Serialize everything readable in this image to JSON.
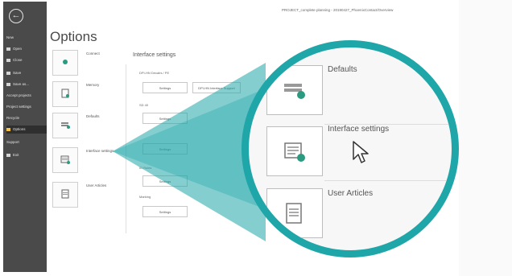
{
  "titlebar": {
    "text": "PROJECT_complete planning - 20190427_PhoenixContact/Overview"
  },
  "sidebar": {
    "back_icon": "back-arrow-icon",
    "items": [
      {
        "label": "New",
        "icon": ""
      },
      {
        "label": "Open",
        "icon": "open-icon"
      },
      {
        "label": "Close",
        "icon": "close-icon"
      },
      {
        "label": "Save",
        "icon": "save-icon"
      },
      {
        "label": "Save as...",
        "icon": "save-as-icon"
      },
      {
        "label": "Accept projects",
        "icon": ""
      },
      {
        "label": "Project settings",
        "icon": ""
      },
      {
        "label": "Recycle",
        "icon": ""
      },
      {
        "label": "Options",
        "icon": "options-icon",
        "active": true
      },
      {
        "label": "Support",
        "icon": ""
      },
      {
        "label": "Exit",
        "icon": "exit-icon"
      }
    ]
  },
  "main": {
    "page_title": "Options",
    "tiles": [
      {
        "label": "Connect",
        "icon": "connect-icon"
      },
      {
        "label": "Memory",
        "icon": "memory-icon"
      },
      {
        "label": "Defaults",
        "icon": "defaults-icon"
      },
      {
        "label": "Interface settings",
        "icon": "interface-settings-icon"
      },
      {
        "label": "User Articles",
        "icon": "user-articles-icon"
      }
    ],
    "panel_heading": "Interface settings",
    "groups": [
      {
        "label": "DPI-HN Decalrs / PE",
        "buttons": [
          "Settings",
          "DPI-HN Interface Support"
        ]
      },
      {
        "label": "SD 40",
        "buttons": [
          "Settings"
        ]
      },
      {
        "label": "",
        "buttons": [
          "Settings"
        ]
      },
      {
        "label": "ID Rules",
        "buttons": [
          "Settings"
        ]
      },
      {
        "label": "Marking",
        "buttons": [
          "Settings"
        ]
      }
    ]
  },
  "lens": {
    "items": [
      {
        "label": "Defaults",
        "icon": "defaults-icon"
      },
      {
        "label": "Interface settings",
        "icon": "interface-settings-icon"
      },
      {
        "label": "User Articles",
        "icon": "user-articles-icon"
      }
    ],
    "cursor_icon": "mouse-pointer-icon"
  },
  "colors": {
    "accent": "#1fa6a8",
    "sidebar": "#4a4a4a",
    "active_icon": "#f3c24b"
  }
}
